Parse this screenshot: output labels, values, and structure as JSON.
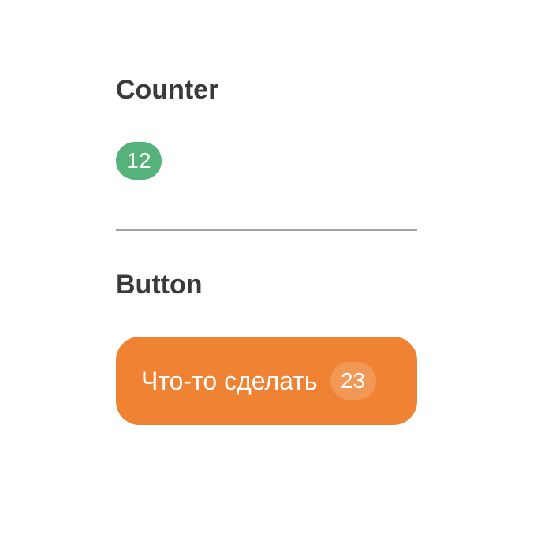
{
  "sections": {
    "counter": {
      "title": "Counter",
      "badge_value": "12"
    },
    "button": {
      "title": "Button",
      "label": "Что-то сделать",
      "badge_value": "23"
    }
  },
  "colors": {
    "counter_badge": "#55b27a",
    "button_background": "#ef8233",
    "title_text": "#3a3a3a",
    "divider": "#a3a3a3"
  }
}
